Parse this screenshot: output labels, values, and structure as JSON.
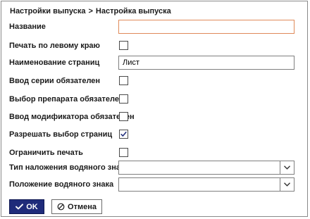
{
  "breadcrumb": {
    "parent": "Настройки выпуска",
    "separator": ">",
    "current": "Настройка выпуска"
  },
  "fields": {
    "name": {
      "label": "Название",
      "value": "",
      "invalid": true
    },
    "print_left": {
      "label": "Печать по левому краю",
      "checked": false
    },
    "page_name": {
      "label": "Наименование страниц",
      "value": "Лист"
    },
    "series_required": {
      "label": "Ввод серии обязателен",
      "checked": false
    },
    "drug_required": {
      "label": "Выбор препарата обязателен",
      "checked": false
    },
    "modifier_required": {
      "label": "Ввод модификатора обязателен",
      "checked": false
    },
    "allow_page_select": {
      "label": "Разрешать выбор страниц",
      "checked": true
    },
    "limit_print": {
      "label": "Ограничить печать",
      "checked": false
    },
    "watermark_type": {
      "label": "Тип наложения водяного знака",
      "value": ""
    },
    "watermark_position": {
      "label": "Положение водяного знака",
      "value": ""
    }
  },
  "buttons": {
    "ok": {
      "label": "OK",
      "icon": "check-icon"
    },
    "cancel": {
      "label": "Отмена",
      "icon": "cancel-circle-icon"
    }
  },
  "colors": {
    "primary": "#1f2b7a",
    "checkmark": "#1f2b7a",
    "error_border": "#e08a5a"
  }
}
